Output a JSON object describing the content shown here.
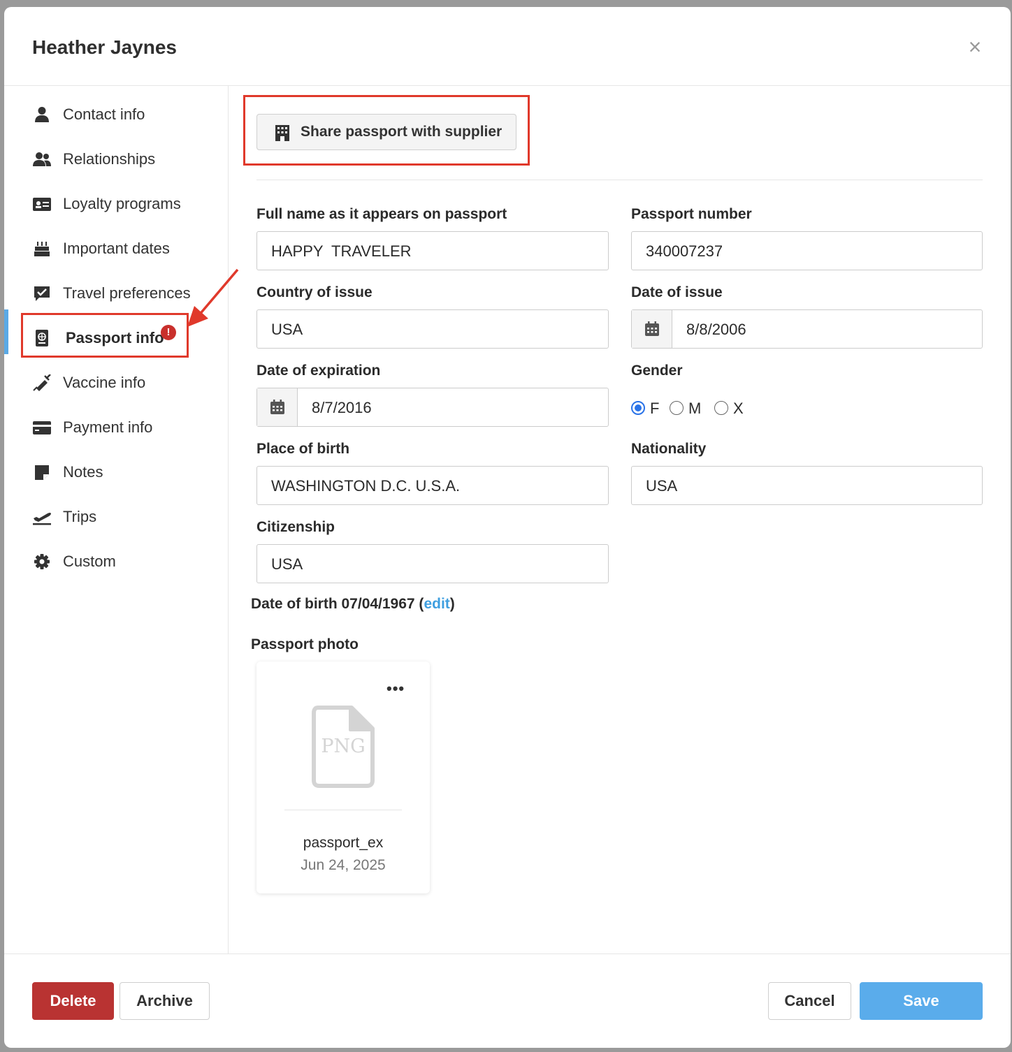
{
  "modal": {
    "title": "Heather Jaynes",
    "close_label": "×"
  },
  "sidebar": {
    "items": [
      {
        "label": "Contact info",
        "icon": "user-icon"
      },
      {
        "label": "Relationships",
        "icon": "users-icon"
      },
      {
        "label": "Loyalty programs",
        "icon": "id-card-icon"
      },
      {
        "label": "Important dates",
        "icon": "birthday-cake-icon"
      },
      {
        "label": "Travel preferences",
        "icon": "comment-check-icon"
      },
      {
        "label": "Passport info",
        "icon": "passport-icon",
        "active": true,
        "warning": "!"
      },
      {
        "label": "Vaccine info",
        "icon": "syringe-icon"
      },
      {
        "label": "Payment info",
        "icon": "credit-card-icon"
      },
      {
        "label": "Notes",
        "icon": "sticky-note-icon"
      },
      {
        "label": "Trips",
        "icon": "plane-departure-icon"
      },
      {
        "label": "Custom",
        "icon": "gear-icon"
      }
    ]
  },
  "passport": {
    "share_button": "Share passport with supplier",
    "fields": {
      "full_name": {
        "label": "Full name as it appears on passport",
        "value": "HAPPY  TRAVELER"
      },
      "passport_number": {
        "label": "Passport number",
        "value": "340007237"
      },
      "country_of_issue": {
        "label": "Country of issue",
        "value": "USA"
      },
      "date_of_issue": {
        "label": "Date of issue",
        "value": "8/8/2006"
      },
      "date_of_expiration": {
        "label": "Date of expiration",
        "value": "8/7/2016"
      },
      "gender": {
        "label": "Gender",
        "options": [
          "F",
          "M",
          "X"
        ],
        "selected": "F"
      },
      "place_of_birth": {
        "label": "Place of birth",
        "value": "WASHINGTON D.C. U.S.A."
      },
      "nationality": {
        "label": "Nationality",
        "value": "USA"
      },
      "citizenship": {
        "label": "Citizenship",
        "value": "USA"
      }
    },
    "dob": {
      "prefix": "Date of birth 07/04/1967 (",
      "edit": "edit",
      "suffix": ")"
    },
    "photo": {
      "label": "Passport photo",
      "file_type": "PNG",
      "file_name": "passport_ex",
      "date": "Jun 24, 2025",
      "more": "•••"
    }
  },
  "footer": {
    "delete": "Delete",
    "archive": "Archive",
    "cancel": "Cancel",
    "save": "Save"
  },
  "colors": {
    "accent": "#5aaceb",
    "danger": "#b93332",
    "annotation": "#e0392b",
    "warning": "#c9302c"
  }
}
